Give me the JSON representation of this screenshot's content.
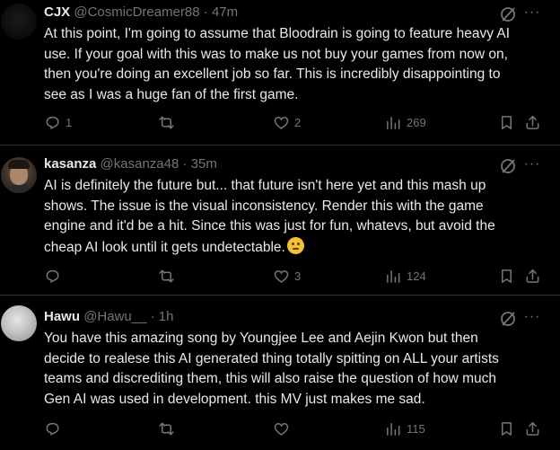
{
  "posts": [
    {
      "name": "CJX",
      "handle": "@CosmicDreamer88",
      "dot": "·",
      "time": "47m",
      "text_lines": [
        "At this point, I'm going to assume that Bloodrain is going to feature heavy AI",
        "use.  If your goal with this was to make us not buy your games from now on,",
        "then you're doing an excellent job so far.  This is incredibly disappointing to",
        "see as I was a huge fan of the first game."
      ],
      "replies": "1",
      "reposts": "",
      "likes": "2",
      "views": "269",
      "more_label": "···"
    },
    {
      "name": "kasanza",
      "handle": "@kasanza48",
      "dot": "·",
      "time": "35m",
      "text_lines": [
        "AI is definitely the future but... that future isn't here yet and this mash up",
        "shows. The issue is the visual inconsistency. Render this with the game",
        "engine and it'd be a hit. Since this was just for fun, whatevs, but avoid the",
        "cheap AI look until it gets undetectable."
      ],
      "emoji": "thinking-face-emoji",
      "replies": "",
      "reposts": "",
      "likes": "3",
      "views": "124",
      "more_label": "···"
    },
    {
      "name": "Hawu",
      "handle": "@Hawu__",
      "dot": "·",
      "time": "1h",
      "text_lines": [
        "You have this amazing song by Youngjee Lee and Aejin Kwon but then",
        "decide to realese this AI generated thing totally spitting on ALL your artists",
        "teams and discrediting them, this will also raise the question of how much",
        "Gen AI was used in development. this MV just makes me sad."
      ],
      "replies": "",
      "reposts": "",
      "likes": "",
      "views": "115",
      "more_label": "···"
    }
  ],
  "icons": {
    "reply": "reply-icon",
    "repost": "repost-icon",
    "like": "like-icon",
    "views": "views-icon",
    "bookmark": "bookmark-icon",
    "share": "share-icon",
    "grok": "grok-icon",
    "more": "more-icon"
  },
  "colors": {
    "background": "#000000",
    "text": "#e7e9ea",
    "muted": "#71767b",
    "divider": "#2f3336"
  }
}
